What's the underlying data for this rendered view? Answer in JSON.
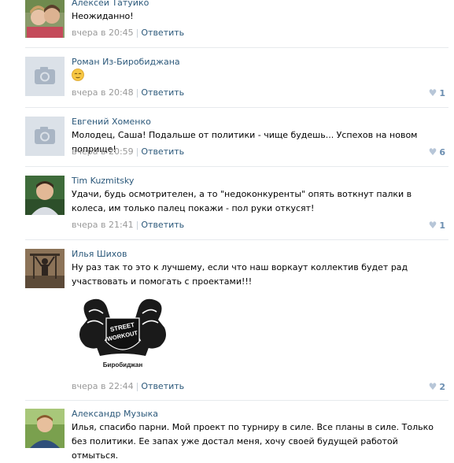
{
  "comments": [
    {
      "author": "Алексей Татуйко",
      "text": "Неожиданно!",
      "time": "вчера в 20:45",
      "reply": "Ответить",
      "likes": "",
      "avatar": "photo-avatar"
    },
    {
      "author": "Роман Из-Биробиджана",
      "text": "",
      "emoji": "relieved-face-emoji",
      "time": "вчера в 20:48",
      "reply": "Ответить",
      "likes": "1",
      "avatar": "camera-placeholder-icon"
    },
    {
      "author": "Евгений Хоменко",
      "text": "Молодец, Саша! Подальше от политики - чище будешь... Успехов на новом поприще!",
      "time": "вчера в 20:59",
      "reply": "Ответить",
      "likes": "6",
      "avatar": "camera-placeholder-icon"
    },
    {
      "author": "Tim Kuzmitsky",
      "text": "Удачи, будь осмотрителен, а то \"недоконкуренты\" опять воткнут палки в колеса, им только палец покажи - пол руки откусят!",
      "time": "вчера в 21:41",
      "reply": "Ответить",
      "likes": "1",
      "avatar": "photo-avatar"
    },
    {
      "author": "Илья Шихов",
      "text": "Ну раз так то это к лучшему, если что наш воркаут коллектив будет рад участвовать и помогать с проектами!!!",
      "image_text_1": "STREET",
      "image_text_2": "WORKOUT",
      "image_caption": "Биробиджан",
      "time": "вчера в 22:44",
      "reply": "Ответить",
      "likes": "2",
      "avatar": "photo-avatar"
    },
    {
      "author": "Александр Музыка",
      "text": "Илья, спасибо парни. Мой проект по турниру в силе. Все планы в силе. Только без политики. Ее запах уже достал меня, хочу своей будущей работой отмыться.",
      "avatar": "photo-avatar"
    }
  ],
  "colors": {
    "link": "#2b587a",
    "meta": "#999999",
    "divider": "#e7eaed",
    "like": "#6a8db0"
  },
  "icons": {
    "like": "heart-icon"
  }
}
